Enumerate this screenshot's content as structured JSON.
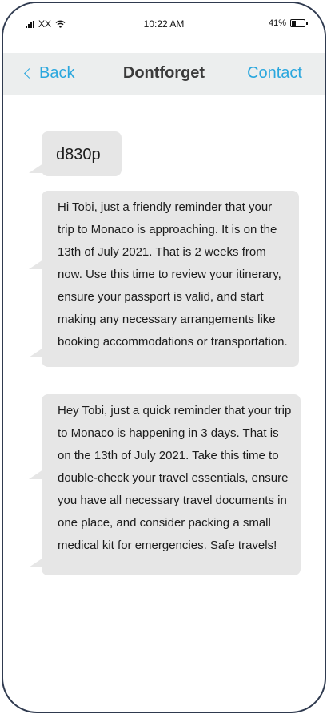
{
  "status_bar": {
    "carrier": "XX",
    "time": "10:22 AM",
    "battery_percent": "41%",
    "battery_level": 0.41,
    "icons": [
      "signal-icon",
      "wifi-icon",
      "battery-icon"
    ]
  },
  "nav": {
    "back_label": "Back",
    "title": "Dontforget",
    "contact_label": "Contact"
  },
  "messages": [
    {
      "text": "d830p"
    },
    {
      "text": "Hi Tobi, just a friendly reminder that your trip to Monaco is approaching. It is on the 13th of July 2021. That is 2 weeks from now. Use this time to review your itinerary, ensure your passport is valid, and start making any necessary arrangements like booking accommodations or transportation."
    },
    {
      "text": "Hey Tobi, just a quick reminder that your trip to Monaco is happening in 3 days. That is on the 13th of July 2021. Take this time to double-check your travel essentials, ensure you have all necessary travel documents in one place, and consider packing a small medical kit for emergencies. Safe travels!"
    }
  ],
  "colors": {
    "accent": "#2aa7de",
    "bubble": "#e6e6e6",
    "nav_background": "#eceeee",
    "frame": "#2f3a4f"
  }
}
